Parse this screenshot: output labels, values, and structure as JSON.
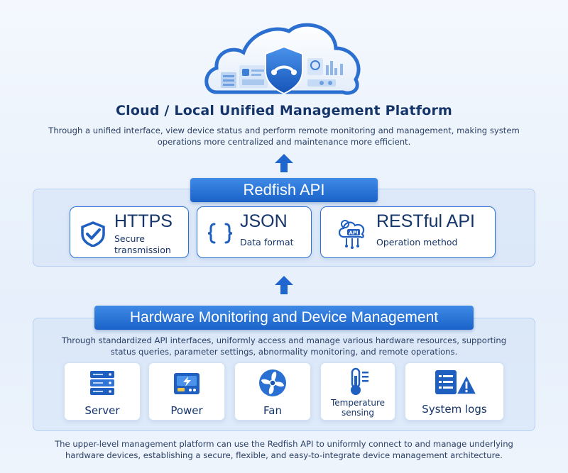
{
  "platform": {
    "title": "Cloud / Local Unified Management Platform",
    "description": "Through a unified interface, view device status and perform remote monitoring and management, making system operations more centralized and maintenance more efficient."
  },
  "redfish": {
    "title": "Redfish API",
    "cards": [
      {
        "title": "HTTPS",
        "subtitle_line1": "Secure",
        "subtitle_line2": "transmission",
        "icon": "shield-check-icon"
      },
      {
        "title": "JSON",
        "subtitle": "Data format",
        "icon": "braces-icon"
      },
      {
        "title": "RESTful API",
        "subtitle": "Operation method",
        "icon": "api-gear-icon"
      }
    ]
  },
  "hardware": {
    "title": "Hardware Monitoring and Device Management",
    "description": "Through standardized API interfaces, uniformly access and manage various hardware resources, supporting status queries, parameter settings, abnormality monitoring, and remote operations.",
    "items": [
      {
        "label": "Server",
        "icon": "server-icon"
      },
      {
        "label": "Power",
        "icon": "power-supply-icon"
      },
      {
        "label": "Fan",
        "icon": "fan-icon"
      },
      {
        "label_line1": "Temperature",
        "label_line2": "sensing",
        "icon": "thermometer-icon"
      },
      {
        "label": "System logs",
        "icon": "log-warning-icon"
      }
    ]
  },
  "footer": {
    "description": "The upper-level management platform can use the Redfish API to uniformly connect to and manage underlying hardware devices, establishing a secure, flexible, and easy-to-integrate device management architecture."
  },
  "icon_labels": {
    "api_badge": "API"
  },
  "colors": {
    "primary": "#1a62c9",
    "primary_light": "#3f8ae6",
    "text_dark": "#15356a",
    "warning": "#1f5fbf"
  }
}
